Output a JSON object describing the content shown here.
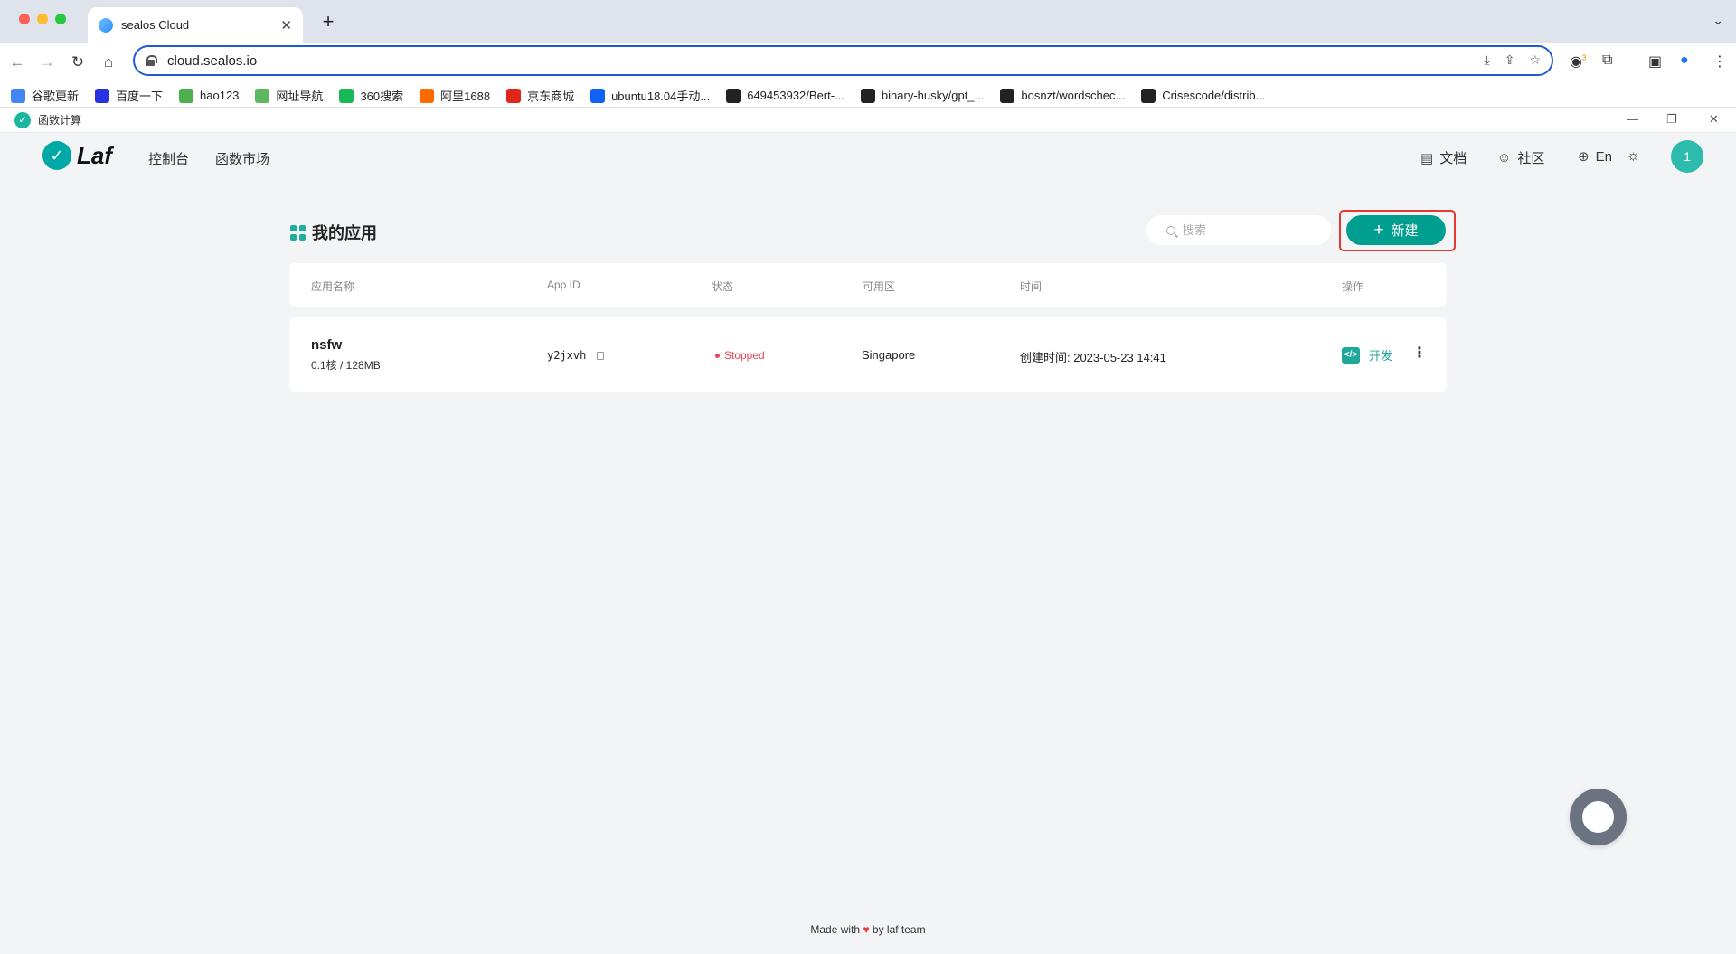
{
  "browser": {
    "tab_title": "sealos Cloud",
    "url": "cloud.sealos.io",
    "bookmarks": [
      {
        "label": "谷歌更新",
        "color": "#4285f4"
      },
      {
        "label": "百度一下",
        "color": "#2932e1"
      },
      {
        "label": "hao123",
        "color": "#4caf50"
      },
      {
        "label": "网址导航",
        "color": "#5bb75b"
      },
      {
        "label": "360搜索",
        "color": "#19b955"
      },
      {
        "label": "阿里1688",
        "color": "#ff6a00"
      },
      {
        "label": "京东商城",
        "color": "#e1251b"
      },
      {
        "label": "ubuntu18.04手动...",
        "color": "#0e63f4"
      },
      {
        "label": "649453932/Bert-...",
        "color": "#222222"
      },
      {
        "label": "binary-husky/gpt_...",
        "color": "#222222"
      },
      {
        "label": "bosnzt/wordschec...",
        "color": "#222222"
      },
      {
        "label": "Crisescode/distrib...",
        "color": "#222222"
      }
    ],
    "extension_badge": "3"
  },
  "window": {
    "title": "函数计算"
  },
  "header": {
    "logo_text": "Laf",
    "nav": [
      "控制台",
      "函数市场"
    ],
    "docs_label": "文档",
    "community_label": "社区",
    "lang_label": "En",
    "avatar_text": "1"
  },
  "main": {
    "title": "我的应用",
    "search_placeholder": "搜索",
    "new_button_label": "新建",
    "columns": {
      "name": "应用名称",
      "app_id": "App ID",
      "status": "状态",
      "region": "可用区",
      "time": "时间",
      "actions": "操作"
    },
    "apps": [
      {
        "name": "nsfw",
        "spec": "0.1核 / 128MB",
        "app_id": "y2jxvh",
        "status": "Stopped",
        "region": "Singapore",
        "created": "创建时间: 2023-05-23 14:41",
        "action_label": "开发"
      }
    ]
  },
  "footer": {
    "prefix": "Made with",
    "suffix": "by laf team"
  },
  "colors": {
    "accent": "#009e8f",
    "status_stopped": "#e8425a",
    "highlight_box": "#e53935"
  }
}
